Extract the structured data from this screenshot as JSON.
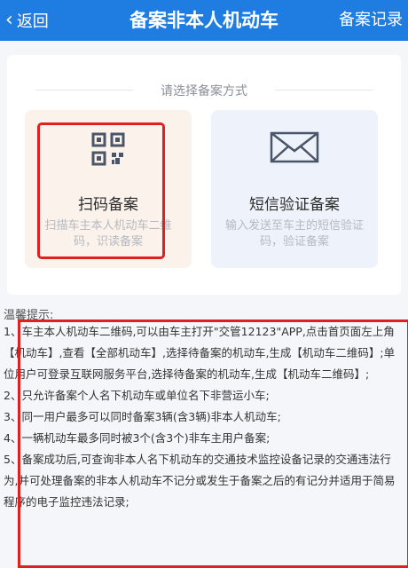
{
  "nav": {
    "back_label": "返回",
    "title": "备案非本人机动车",
    "right_label": "备案记录"
  },
  "choose": {
    "title": "请选择备案方式"
  },
  "methods": [
    {
      "label": "扫码备案",
      "desc": "扫描车主本人机动车二维码，识读备案",
      "icon": "qr-code-icon"
    },
    {
      "label": "短信验证备案",
      "desc": "输入发送至车主的短信验证码，验证备案",
      "icon": "envelope-icon"
    }
  ],
  "tips": {
    "title": "温馨提示:",
    "items": [
      "1、车主本人机动车二维码,可以由车主打开\"交管12123\"APP,点击首页面左上角【机动车】,查看【全部机动车】,选择待备案的机动车,生成【机动车二维码】;单位用户可登录互联网服务平台,选择待备案的机动车,生成【机动车二维码】;",
      "2、只允许备案个人名下机动车或单位名下非营运小车;",
      "3、同一用户最多可以同时备案3辆(含3辆)非本人机动车;",
      "4、一辆机动车最多同时被3个(含3个)非车主用户备案;",
      "5、备案成功后,可查询非本人名下机动车的交通技术监控设备记录的交通违法行为,并可处理备案的非本人机动车不记分或发生于备案之后的有记分并适用于简易程序的电子监控违法记录;"
    ]
  },
  "colors": {
    "primary": "#1f7ce0",
    "highlight": "#e02020"
  }
}
